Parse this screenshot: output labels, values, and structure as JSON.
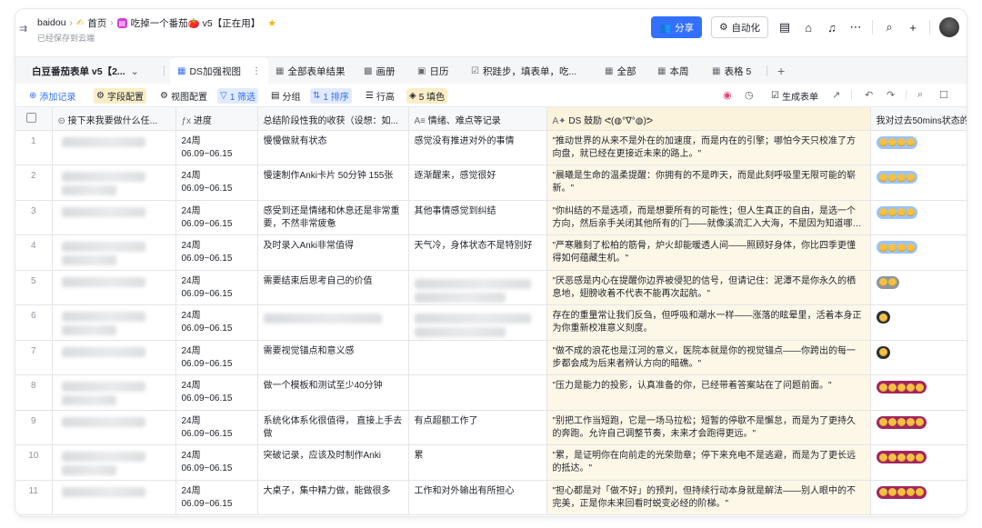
{
  "header": {
    "crumbs": [
      "baidou",
      "首页",
      "吃掉一个番茄🍅 v5【正在用】"
    ],
    "saved_status": "已经保存到云端",
    "share_label": "分享",
    "automation_label": "自动化"
  },
  "tabs": {
    "table_name": "白豆番茄表单 v5【2...",
    "items": [
      {
        "label": "DS加强视图",
        "active": true
      },
      {
        "label": "全部表单结果"
      },
      {
        "label": "画册"
      },
      {
        "label": "日历"
      },
      {
        "label": "积跬步，填表单，吃..."
      },
      {
        "label": "全部"
      },
      {
        "label": "本周"
      },
      {
        "label": "表格 5"
      }
    ]
  },
  "toolbar": {
    "add_record": "添加记录",
    "field_config": "字段配置",
    "view_config": "视图配置",
    "filter": "1 筛选",
    "group": "分组",
    "sort": "1 排序",
    "row_height": "行高",
    "fill": "5 填色",
    "generate_form": "生成表单"
  },
  "columns": {
    "c1": "接下来我要做什么任...",
    "c2": "进度",
    "c3": "总结阶段性我的收获（设想：如...",
    "c4": "情绪、难点等记录",
    "c5": "DS 鼓励 ᕙ(◍°∇°◍)ᕗ",
    "c6": "我对过去50mins状态的"
  },
  "rows": [
    {
      "idx": "1",
      "week": "24周",
      "range": "06.09~06.15",
      "gain": "慢慢做就有状态",
      "mood": "感觉没有推进对外的事情",
      "ds": "\"推动世界的从来不是外在的加速度，而是内在的引擎；哪怕今天只校准了方向盘，就已经在更接近未来的路上。\"",
      "rating": 4,
      "color": "lb"
    },
    {
      "idx": "2",
      "week": "24周",
      "range": "06.09~06.15",
      "gain": "慢速制作Anki卡片 50分钟 155张",
      "mood": "逐渐醒来，感觉很好",
      "ds": "\"晨曦是生命的温柔提醒：你拥有的不是昨天，而是此刻呼吸里无限可能的崭新。\"",
      "rating": 4,
      "color": "lb"
    },
    {
      "idx": "3",
      "week": "24周",
      "range": "06.09~06.15",
      "gain": "感受到还是情绪和休息还是非常重要，不然非常疲惫",
      "mood": "其他事情感觉到纠结",
      "ds": "\"你纠结的不是选项，而是想要所有的可能性；但人生真正的自由，是选一个方向，然后亲手关闭其他所有的门——就像溪流汇入大海，不是因为知道哪条...",
      "rating": 4,
      "color": "lb"
    },
    {
      "idx": "4",
      "week": "24周",
      "range": "06.09~06.15",
      "gain": "及时录入Anki非常值得",
      "mood": "天气冷，身体状态不是特别好",
      "ds": "\"严寒雕刻了松柏的筋骨，炉火却能暖透人间——照顾好身体，你比四季更懂得如何蕴藏生机。\"",
      "rating": 4,
      "color": "lb"
    },
    {
      "idx": "5",
      "week": "24周",
      "range": "06.09~06.15",
      "gain": "需要结束后思考自己的价值",
      "mood": "",
      "ds": "\"厌恶感是内心在提醒你边界被侵犯的信号，但请记住：泥潭不是你永久的栖息地，翅膀收着不代表不能再次起航。\"",
      "rating": 2,
      "color": "gy"
    },
    {
      "idx": "6",
      "week": "24周",
      "range": "06.09~06.15",
      "gain": "",
      "mood": "",
      "ds": "存在的重量常让我们反刍，但呼吸和潮水一样——涨落的眩晕里，活着本身正为你重新校准意义刻度。",
      "rating": 1,
      "color": "bk"
    },
    {
      "idx": "7",
      "week": "24周",
      "range": "06.09~06.15",
      "gain": "需要视觉锚点和意义感",
      "mood": "",
      "ds": "\"做不成的浪花也是江河的意义，医院本就是你的视觉锚点——你跨出的每一步都会成为后来者辨认方向的暗礁。\"",
      "rating": 1,
      "color": "bk"
    },
    {
      "idx": "8",
      "week": "24周",
      "range": "06.09~06.15",
      "gain": "做一个模板和测试至少40分钟",
      "mood": "",
      "ds": "\"压力是能力的投影，认真准备的你，已经带着答案站在了问题前面。\"",
      "rating": 5,
      "color": "mg"
    },
    {
      "idx": "9",
      "week": "24周",
      "range": "06.09~06.15",
      "gain": "系统化体系化很值得， 直接上手去做",
      "mood": "有点超额工作了",
      "ds": "\"别把工作当短跑，它是一场马拉松；短暂的停歇不是懈怠，而是为了更持久的奔跑。允许自己调整节奏，未来才会跑得更远。\"",
      "rating": 5,
      "color": "mg"
    },
    {
      "idx": "10",
      "week": "24周",
      "range": "06.09~06.15",
      "gain": "突破记录，应该及时制作Anki",
      "mood": "累",
      "ds": "\"累，是证明你在向前走的光荣勋章；停下来充电不是逃避，而是为了更长远的抵达。\"",
      "rating": 5,
      "color": "mg"
    },
    {
      "idx": "11",
      "week": "24周",
      "range": "06.09~06.15",
      "gain": "大桌子，集中精力做，能做很多",
      "mood": "工作和对外输出有所担心",
      "ds": "\"担心都是对「做不好」的预判，但持续行动本身就是解法——别人眼中的不完美，正是你未来回看时蜕变必经的阶梯。\"",
      "rating": 5,
      "color": "mg"
    }
  ]
}
